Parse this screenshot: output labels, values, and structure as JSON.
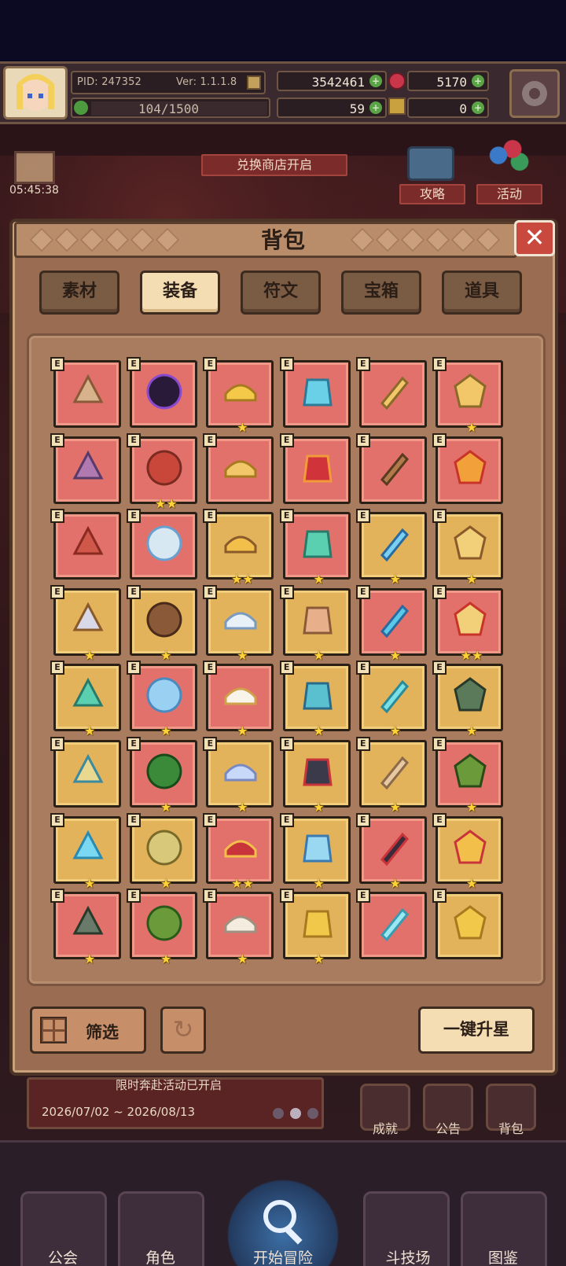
{
  "status": {
    "pid_label": "PID: 247352",
    "version_label": "Ver: 1.1.1.8",
    "gold": "3542461",
    "gems": "5170",
    "stamina": "104/1500",
    "clover": "59",
    "keys": "0"
  },
  "world": {
    "timer": "05:45:38",
    "shop_ribbon": "兑换商店开启",
    "guide_label": "攻略",
    "activity_label": "活动",
    "event_text": "限时奔赴活动已开启",
    "event_dates": "2026/07/02 ~ 2026/08/13",
    "side_buttons": [
      "成就",
      "公告",
      "背包"
    ]
  },
  "panel": {
    "title": "背包",
    "close_glyph": "✕",
    "tabs": [
      {
        "label": "素材",
        "active": false
      },
      {
        "label": "装备",
        "active": true
      },
      {
        "label": "符文",
        "active": false
      },
      {
        "label": "宝箱",
        "active": false
      },
      {
        "label": "道具",
        "active": false
      }
    ],
    "badge_letter": "E",
    "items": [
      {
        "name": "pastry-helmet",
        "bg": "red",
        "stars": 0
      },
      {
        "name": "dark-orb",
        "bg": "red",
        "stars": 0
      },
      {
        "name": "straw-hat",
        "bg": "red",
        "stars": 1
      },
      {
        "name": "crystal-helmet",
        "bg": "red",
        "stars": 0
      },
      {
        "name": "horned-helm",
        "bg": "red",
        "stars": 0
      },
      {
        "name": "heart-amulet",
        "bg": "red",
        "stars": 1
      },
      {
        "name": "bead-necklace",
        "bg": "red",
        "stars": 0
      },
      {
        "name": "ruby-goblet",
        "bg": "red",
        "stars": 2
      },
      {
        "name": "gold-ring",
        "bg": "red",
        "stars": 0
      },
      {
        "name": "red-blades",
        "bg": "red",
        "stars": 0
      },
      {
        "name": "wooden-staff",
        "bg": "red",
        "stars": 0
      },
      {
        "name": "fire-ring",
        "bg": "red",
        "stars": 0
      },
      {
        "name": "coral-fur",
        "bg": "red",
        "stars": 0
      },
      {
        "name": "crystal-bow",
        "bg": "red",
        "stars": 0
      },
      {
        "name": "golden-rod",
        "bg": "gold",
        "stars": 2
      },
      {
        "name": "jade-bow",
        "bg": "red",
        "stars": 1
      },
      {
        "name": "blue-wand",
        "bg": "gold",
        "stars": 1
      },
      {
        "name": "gem-scepter",
        "bg": "gold",
        "stars": 1
      },
      {
        "name": "battle-axe",
        "bg": "gold",
        "stars": 1
      },
      {
        "name": "wood-mace",
        "bg": "gold",
        "stars": 1
      },
      {
        "name": "silver-mace",
        "bg": "gold",
        "stars": 1
      },
      {
        "name": "amber-scepter",
        "bg": "gold",
        "stars": 1
      },
      {
        "name": "ice-hammer",
        "bg": "red",
        "stars": 1
      },
      {
        "name": "royal-shield",
        "bg": "red",
        "stars": 2
      },
      {
        "name": "teal-spear",
        "bg": "gold",
        "stars": 1
      },
      {
        "name": "frost-dagger",
        "bg": "red",
        "stars": 1
      },
      {
        "name": "white-shield",
        "bg": "red",
        "stars": 1
      },
      {
        "name": "aqua-shield",
        "bg": "gold",
        "stars": 1
      },
      {
        "name": "aqua-orb",
        "bg": "gold",
        "stars": 1
      },
      {
        "name": "stone-orb",
        "bg": "gold",
        "stars": 1
      },
      {
        "name": "magic-lamp",
        "bg": "gold",
        "stars": 0
      },
      {
        "name": "green-cloak",
        "bg": "red",
        "stars": 1
      },
      {
        "name": "silver-crown",
        "bg": "gold",
        "stars": 1
      },
      {
        "name": "dark-armor",
        "bg": "gold",
        "stars": 1
      },
      {
        "name": "tan-cloak",
        "bg": "gold",
        "stars": 1
      },
      {
        "name": "leaf-cloak",
        "bg": "red",
        "stars": 1
      },
      {
        "name": "ice-cloak",
        "bg": "gold",
        "stars": 1
      },
      {
        "name": "gold-vest",
        "bg": "gold",
        "stars": 1
      },
      {
        "name": "crimson-robe",
        "bg": "red",
        "stars": 2
      },
      {
        "name": "frost-armor",
        "bg": "gold",
        "stars": 1
      },
      {
        "name": "demon-armor",
        "bg": "red",
        "stars": 1
      },
      {
        "name": "sun-robe",
        "bg": "gold",
        "stars": 1
      },
      {
        "name": "moss-armor",
        "bg": "red",
        "stars": 1
      },
      {
        "name": "forest-robe",
        "bg": "red",
        "stars": 1
      },
      {
        "name": "ivory-robe",
        "bg": "red",
        "stars": 1
      },
      {
        "name": "gold-plate",
        "bg": "gold",
        "stars": 1
      },
      {
        "name": "glacier-robe",
        "bg": "red",
        "stars": 0
      },
      {
        "name": "amber-plate",
        "bg": "gold",
        "stars": 0
      }
    ],
    "filter_label": "筛选",
    "upgrade_label": "一键升星"
  },
  "nav": {
    "items": [
      "公会",
      "角色",
      "开始冒险",
      "斗技场",
      "图鉴"
    ]
  },
  "colors": {
    "slot_red": "#e1716a",
    "slot_gold": "#e2b35a",
    "star": "#ffd23a",
    "active_tab": "#f5ddb3"
  }
}
